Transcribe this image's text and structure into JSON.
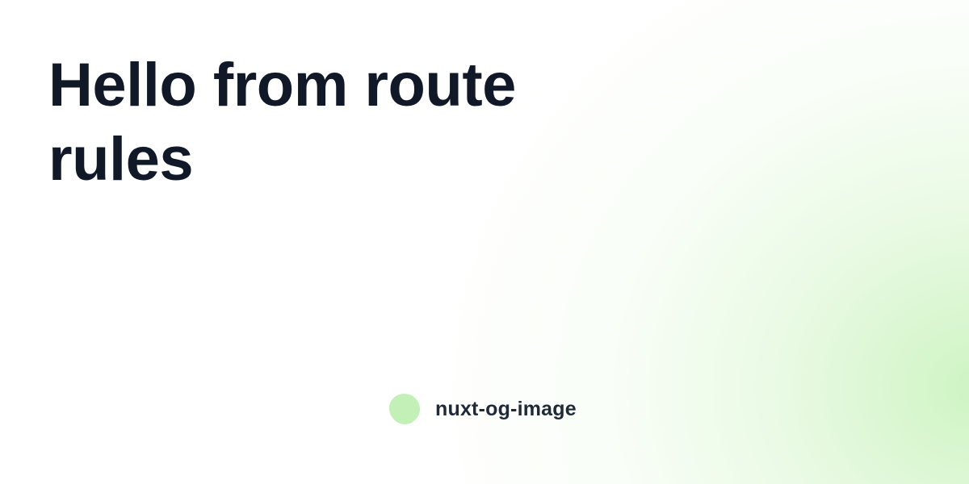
{
  "title": "Hello from route rules",
  "brand": {
    "name": "nuxt-og-image",
    "logo_icon": "blob-icon",
    "logo_color": "#c3f0b7"
  },
  "colors": {
    "title": "#111827",
    "brand_text": "#1f2937",
    "glow": "#c8f2bb",
    "background": "#ffffff"
  }
}
